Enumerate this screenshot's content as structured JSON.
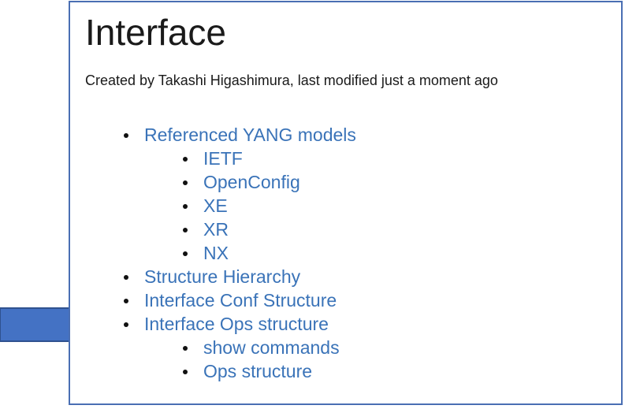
{
  "page": {
    "title": "Interface",
    "byline": "Created by Takashi Higashimura, last modified just a moment ago"
  },
  "nav": {
    "items": [
      {
        "label": "Referenced YANG models",
        "children": [
          {
            "label": "IETF"
          },
          {
            "label": "OpenConfig"
          },
          {
            "label": "XE"
          },
          {
            "label": "XR"
          },
          {
            "label": "NX"
          }
        ]
      },
      {
        "label": "Structure Hierarchy"
      },
      {
        "label": "Interface Conf Structure"
      },
      {
        "label": "Interface Ops structure",
        "children": [
          {
            "label": "show commands"
          },
          {
            "label": "Ops structure"
          }
        ]
      }
    ]
  },
  "colors": {
    "link": "#3a73b8",
    "frame_border": "#4a6fb3",
    "arrow_fill": "#4472c4",
    "arrow_stroke": "#2f528f",
    "text": "#1a1a1a"
  },
  "icons": {
    "pointer": "right-arrow-icon"
  }
}
